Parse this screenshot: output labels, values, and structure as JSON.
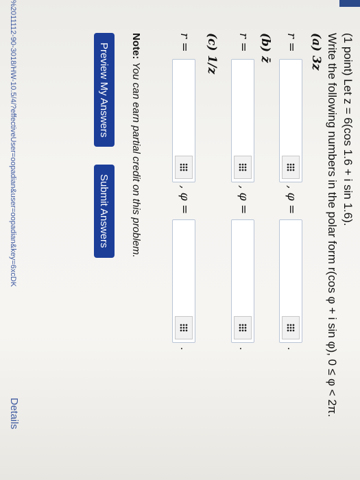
{
  "problem": {
    "statement_line1": "(1 point) Let z = 6(cos 1.6 + i sin 1.6).",
    "statement_line2": "Write the following numbers in the polar form r(cos φ + i sin φ), 0 ≤ φ < 2π.",
    "part_a_label": "(a) 3z",
    "part_b_label": "(b) z̄",
    "part_c_label": "(c) 1/z",
    "r_label": "r =",
    "phi_label": ", φ =",
    "period": "."
  },
  "answers": {
    "a_r": "",
    "a_phi": "",
    "b_r": "",
    "b_phi": "",
    "c_r": "",
    "c_phi": ""
  },
  "note_prefix": "Note:",
  "note_text": "You can earn partial credit on this problem.",
  "buttons": {
    "preview": "Preview My Answers",
    "submit": "Submit Answers"
  },
  "footer": {
    "url_fragment": "%2011112-90-3018/HW-10.5/4/?effectiveUser=oopadian&user=oopadian&key=6xcDK",
    "details_link": "Details"
  },
  "icons": {
    "math_entry": "grid-icon"
  },
  "colors": {
    "button_bg": "#1c3e99",
    "link": "#3e5aa0"
  }
}
